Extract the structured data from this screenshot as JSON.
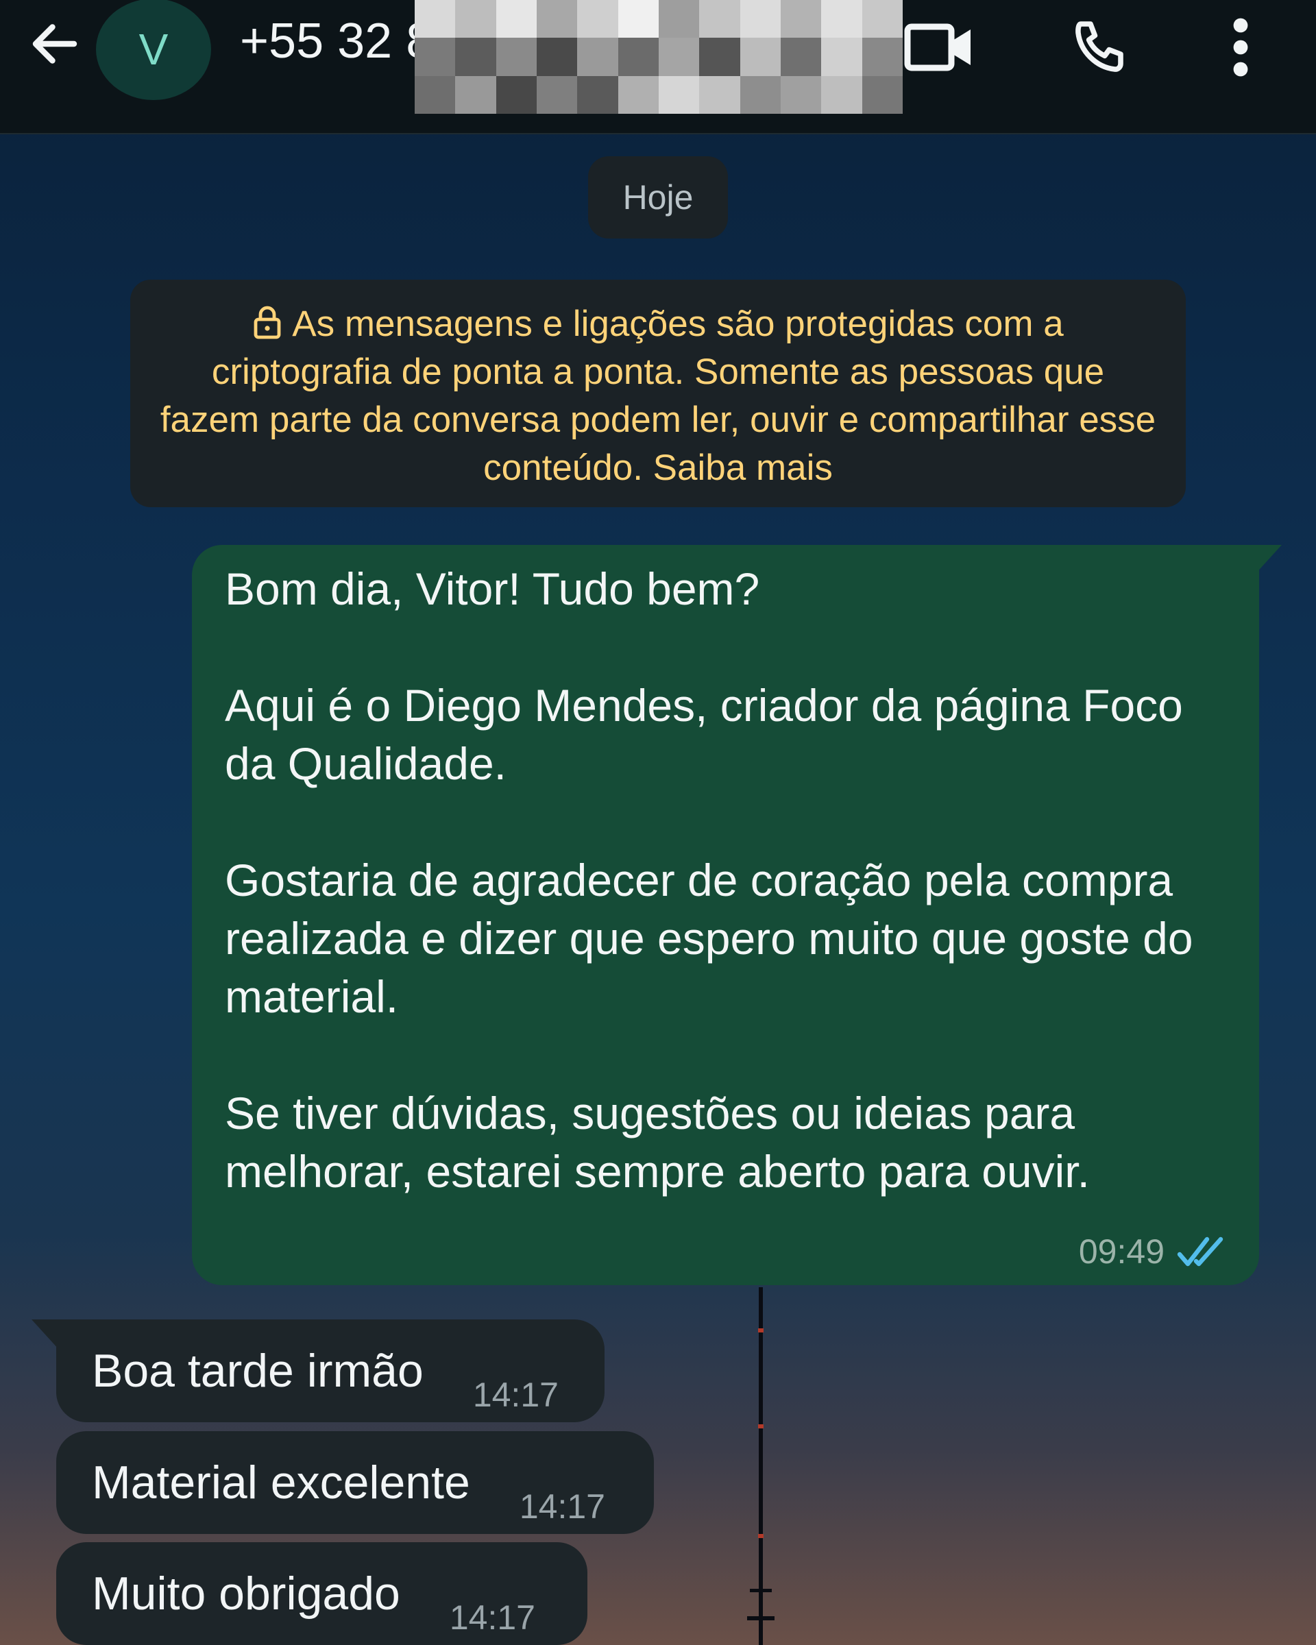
{
  "header": {
    "contact_initial": "V",
    "contact_name": "+55 32 843",
    "redaction_colors": [
      "#d9d9d9",
      "#bdbdbd",
      "#e6e6e6",
      "#a8a8a8",
      "#cfcfcf",
      "#f0f0f0",
      "#9e9e9e",
      "#c4c4c4",
      "#dcdcdc",
      "#b3b3b3",
      "#e0e0e0",
      "#c8c8c8",
      "#7a7a7a",
      "#5c5c5c",
      "#8a8a8a",
      "#4a4a4a",
      "#9a9a9a",
      "#6b6b6b",
      "#a5a5a5",
      "#555555",
      "#bcbcbc",
      "#707070",
      "#d0d0d0",
      "#898989",
      "#6e6e6e",
      "#999999",
      "#484848",
      "#7f7f7f",
      "#5a5a5a",
      "#b0b0b0",
      "#d6d6d6",
      "#c2c2c2",
      "#8e8e8e",
      "#a0a0a0",
      "#bebebe",
      "#777777"
    ],
    "icons": [
      "arrow-left-icon",
      "video-camera-icon",
      "phone-icon",
      "more-vertical-icon"
    ]
  },
  "chat": {
    "date_label": "Hoje",
    "encryption_notice": "As mensagens e ligações são protegidas com a criptografia de ponta a ponta. Somente as pessoas que fazem parte da conversa podem ler, ouvir e compartilhar esse conteúdo. Saiba mais",
    "outgoing_message": {
      "paragraphs": [
        "Bom dia, Vitor! Tudo bem?",
        "Aqui é o Diego Mendes, criador da página Foco da Qualidade.",
        "Gostaria de agradecer de coração pela compra realizada e dizer que espero muito que goste do material.",
        "Se tiver dúvidas, sugestões ou ideias para melhorar, estarei sempre aberto para ouvir."
      ],
      "time": "09:49",
      "status": "read"
    },
    "incoming_messages": [
      {
        "text": "Boa tarde irmão",
        "time": "14:17"
      },
      {
        "text": "Material excelente",
        "time": "14:17"
      },
      {
        "text": "Muito obrigado",
        "time": "14:17"
      }
    ]
  },
  "colors": {
    "header_bg": "#0c1418",
    "outgoing_bubble": "#154c37",
    "incoming_bubble": "#1d2529",
    "system_bubble": "#1b2226",
    "notice_text": "#ffd379",
    "read_ticks": "#53bdeb"
  }
}
